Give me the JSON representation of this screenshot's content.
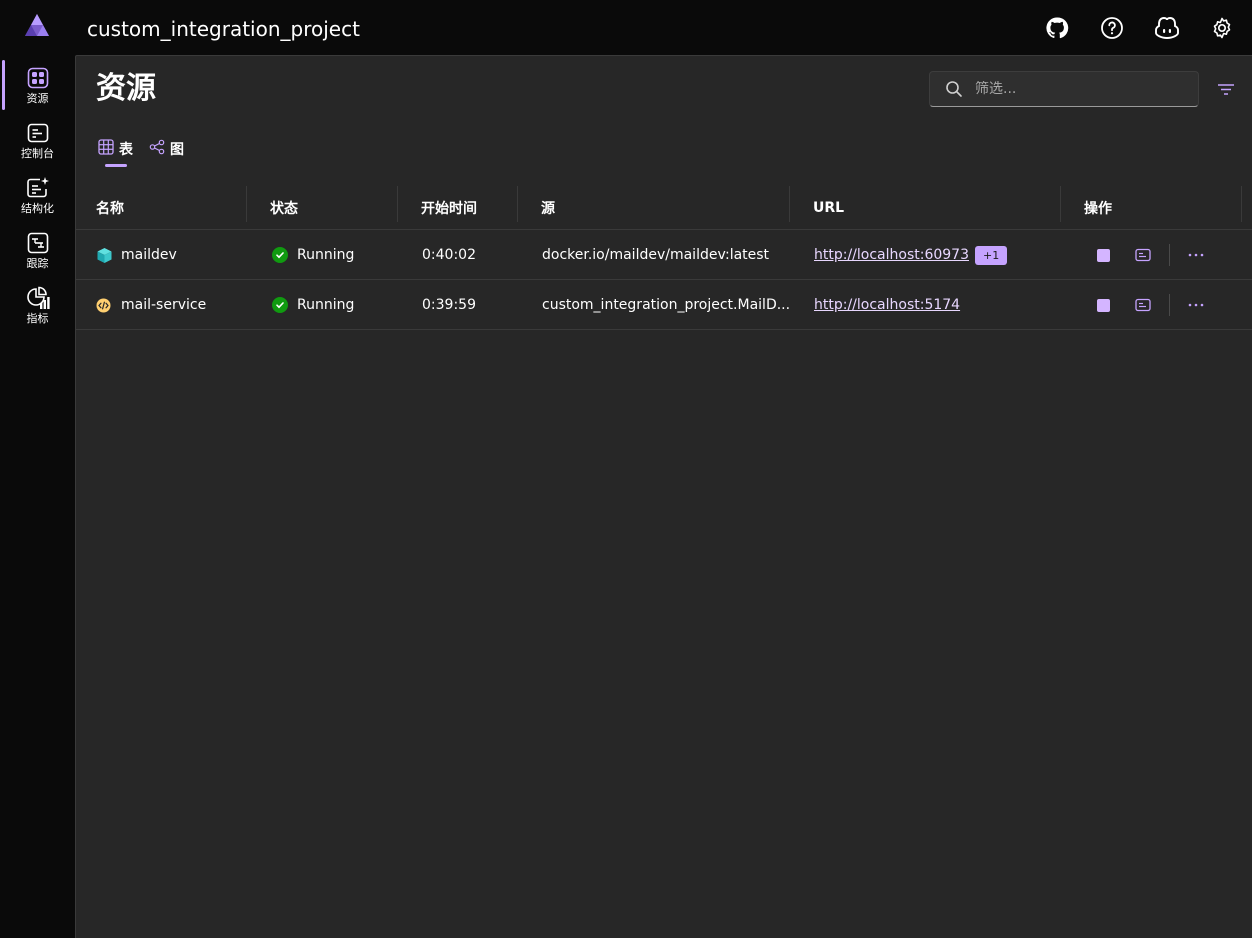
{
  "header": {
    "app_title": "custom_integration_project",
    "icons": [
      "github-icon",
      "help-icon",
      "copilot-icon",
      "settings-icon"
    ]
  },
  "sidenav": {
    "items": [
      {
        "label": "资源",
        "icon": "resources-icon",
        "active": true
      },
      {
        "label": "控制台",
        "icon": "console-icon",
        "active": false
      },
      {
        "label": "结构化",
        "icon": "structured-logs-icon",
        "active": false
      },
      {
        "label": "跟踪",
        "icon": "traces-icon",
        "active": false
      },
      {
        "label": "指标",
        "icon": "metrics-icon",
        "active": false
      }
    ]
  },
  "page": {
    "title": "资源",
    "search_placeholder": "筛选...",
    "tabs": [
      {
        "label": "表",
        "icon": "table-icon",
        "active": true
      },
      {
        "label": "图",
        "icon": "graph-icon",
        "active": false
      }
    ]
  },
  "table": {
    "columns": [
      "名称",
      "状态",
      "开始时间",
      "源",
      "URL",
      "操作"
    ],
    "rows": [
      {
        "name": "maildev",
        "type_icon": "container-icon",
        "state": "Running",
        "start_time": "0:40:02",
        "source": "docker.io/maildev/maildev:latest",
        "url": "http://localhost:60973",
        "url_extra": "+1"
      },
      {
        "name": "mail-service",
        "type_icon": "project-icon",
        "state": "Running",
        "start_time": "0:39:59",
        "source": "custom_integration_project.MailD...",
        "url": "http://localhost:5174",
        "url_extra": ""
      }
    ]
  },
  "colors": {
    "accent": "#c5a3ff",
    "running": "#109a10",
    "panel": "#272727",
    "chrome": "#0a0a0a"
  }
}
